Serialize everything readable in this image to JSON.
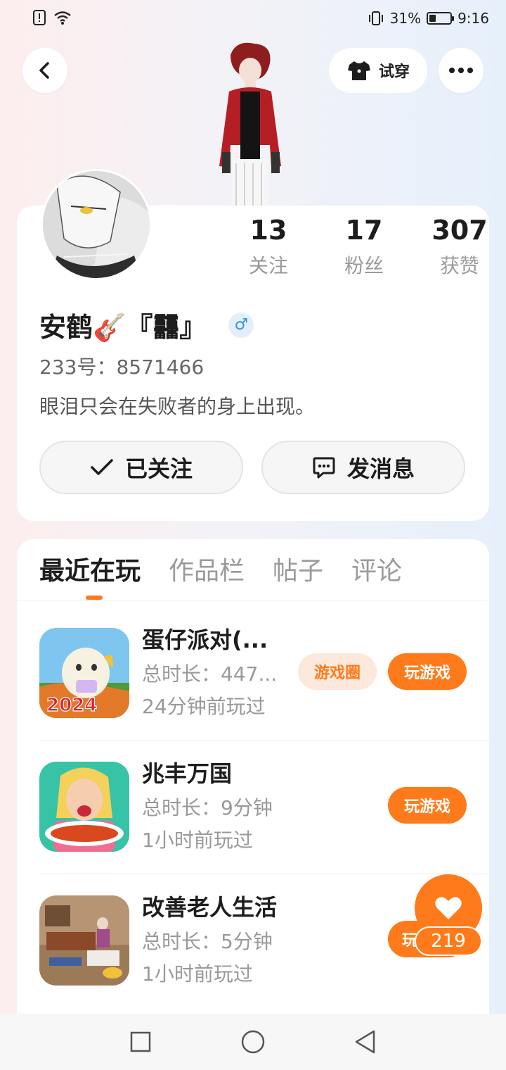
{
  "status": {
    "battery": "31%",
    "battery_level": 0.31,
    "time": "9:16"
  },
  "header": {
    "tryon_label": "试穿"
  },
  "profile": {
    "stats": [
      {
        "value": "13",
        "label": "关注"
      },
      {
        "value": "17",
        "label": "粉丝"
      },
      {
        "value": "307",
        "label": "获赞"
      }
    ],
    "nickname": "安鹤🎸『䨻』",
    "gender_symbol": "♂",
    "uid": "233号：8571466",
    "bio": "眼泪只会在失败者的身上出现。",
    "follow_label": "已关注",
    "message_label": "发消息"
  },
  "tabs": [
    "最近在玩",
    "作品栏",
    "帖子",
    "评论"
  ],
  "games": [
    {
      "title": "蛋仔派对(...",
      "duration": "总时长：447...",
      "last_played": "24分钟前玩过",
      "circle_label": "游戏圈",
      "play_label": "玩游戏",
      "icon_badge": "2024"
    },
    {
      "title": "兆丰万国",
      "duration": "总时长：9分钟",
      "last_played": "1小时前玩过",
      "play_label": "玩游戏"
    },
    {
      "title": "改善老人生活",
      "duration": "总时长：5分钟",
      "last_played": "1小时前玩过",
      "play_label": "玩"
    }
  ],
  "like_fab": {
    "count": "219"
  },
  "colors": {
    "accent": "#ff7a1a",
    "accent_light": "#fde9dc",
    "gender_blue": "#3a8ee6"
  }
}
